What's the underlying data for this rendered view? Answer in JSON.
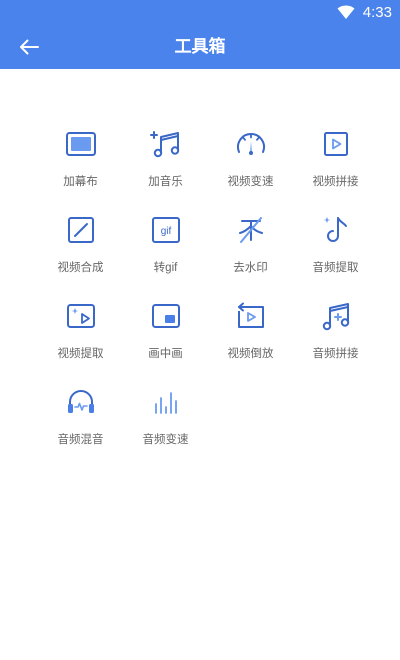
{
  "status_bar": {
    "time": "4:33",
    "wifi_icon": "wifi-icon"
  },
  "header": {
    "title": "工具箱",
    "back_icon": "arrow-left-icon"
  },
  "colors": {
    "header_bg": "#4b83ec",
    "icon_primary": "#4a7fe8",
    "icon_dark": "#3a68c9",
    "label": "#666666"
  },
  "tools": [
    {
      "label": "加幕布",
      "icon": "canvas-icon"
    },
    {
      "label": "加音乐",
      "icon": "add-music-icon"
    },
    {
      "label": "视频变速",
      "icon": "speedometer-icon"
    },
    {
      "label": "视频拼接",
      "icon": "video-join-icon"
    },
    {
      "label": "视频合成",
      "icon": "video-compose-icon"
    },
    {
      "label": "转gif",
      "icon": "gif-icon"
    },
    {
      "label": "去水印",
      "icon": "remove-watermark-icon"
    },
    {
      "label": "音频提取",
      "icon": "audio-extract-icon"
    },
    {
      "label": "视频提取",
      "icon": "video-extract-icon"
    },
    {
      "label": "画中画",
      "icon": "picture-in-picture-icon"
    },
    {
      "label": "视频倒放",
      "icon": "video-reverse-icon"
    },
    {
      "label": "音频拼接",
      "icon": "audio-join-icon"
    },
    {
      "label": "音频混音",
      "icon": "audio-mix-icon"
    },
    {
      "label": "音频变速",
      "icon": "audio-speed-icon"
    }
  ],
  "gif_icon_text": "gif"
}
